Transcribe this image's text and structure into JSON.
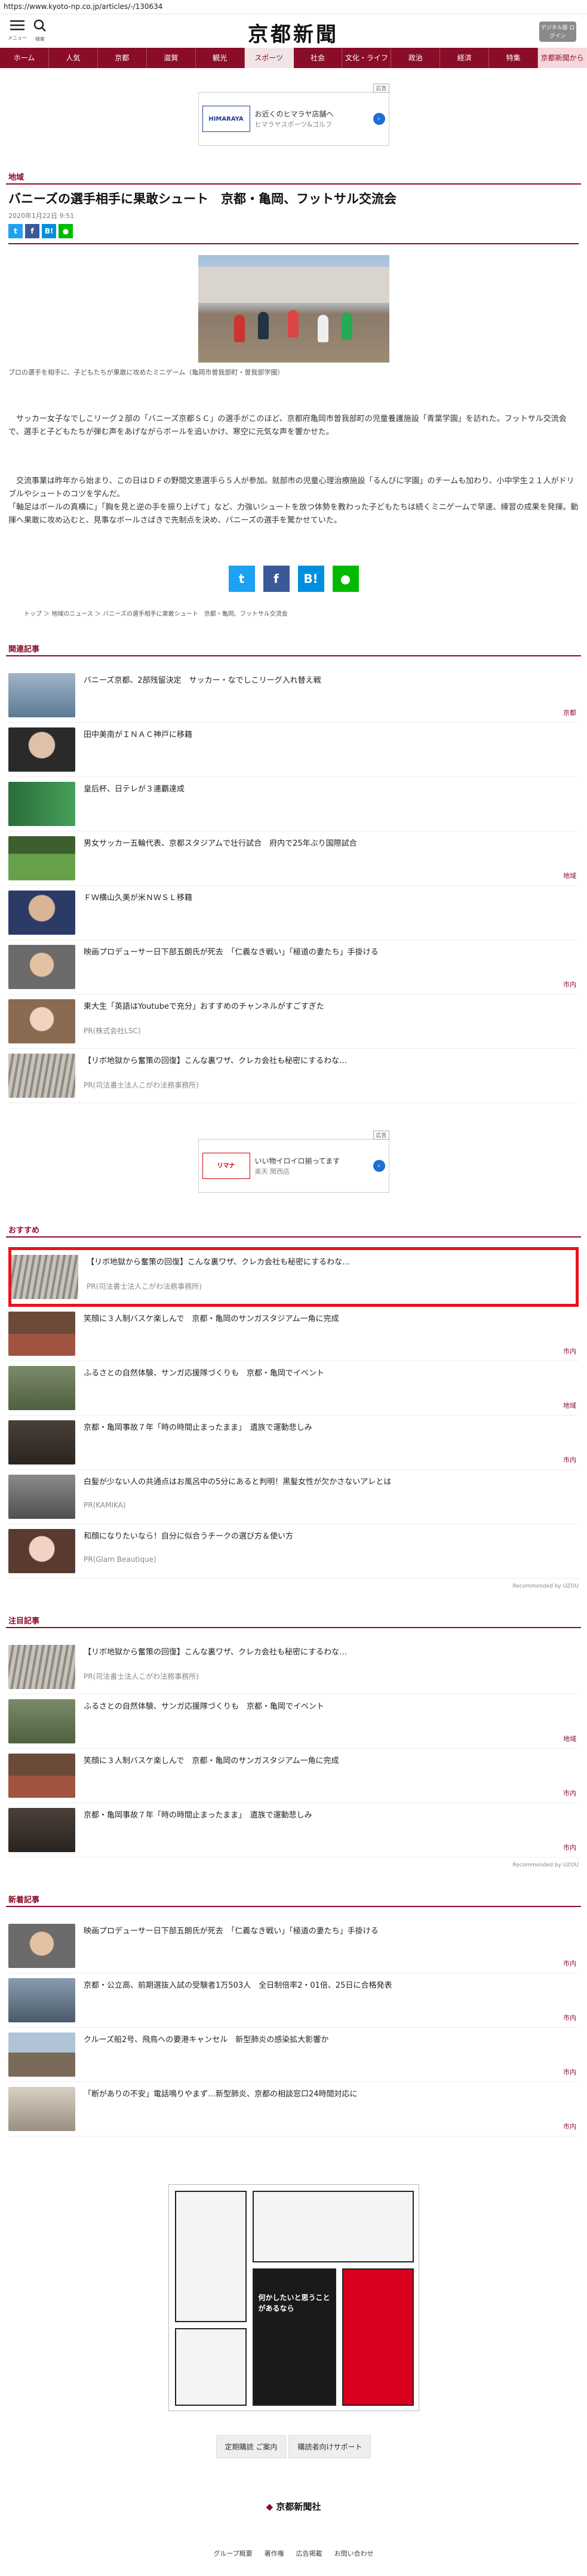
{
  "url": "https://www.kyoto-np.co.jp/articles/-/130634",
  "header": {
    "menu_label": "メニュー",
    "search_label": "検索",
    "logo": "京都新聞",
    "digital_button": "デジタル版 ログイン"
  },
  "nav": [
    "ホーム",
    "人気",
    "京都",
    "滋賀",
    "観光",
    "スポーツ",
    "社会",
    "文化・ライフ",
    "政治",
    "経済",
    "特集",
    "京都新聞から"
  ],
  "nav_active": "スポーツ",
  "top_ad": {
    "label": "広告",
    "logo": "HIMARAYA",
    "text": "お近くのヒマラヤ店舗へ",
    "sub": "ヒマラヤスポーツ&ゴルフ"
  },
  "article": {
    "category": "地域",
    "headline": "バニーズの選手相手に果敢シュート　京都・亀岡、フットサル交流会",
    "date": "2020年1月22日 9:51",
    "caption": "プロの選手を相手に、子どもたちが果敢に攻めたミニゲーム（亀岡市曽我部町・曽我部学園）",
    "paragraphs": [
      "　サッカー女子なでしこリーグ２部の「バニーズ京都ＳＣ」の選手がこのほど、京都府亀岡市曽我部町の児童養護施設「青葉学園」を訪れた。フットサル交流会で、選手と子どもたちが弾む声をあげながらボールを追いかけ、寒空に元気な声を響かせた。",
      "　交流事業は昨年から始まり、この日はＤＦの野間文恵選手ら５人が参加。就部市の児童心理治療施設「るんびに学園」のチームも加わり、小中学生２１人がドリブルやシュートのコツを学んだ。\n「軸足はボールの真横に」「胸を見と逆の手を振り上げて」など、力強いシュートを放つ体勢を教わった子どもたちは続くミニゲームで早速、練習の成果を発揮。動揮へ果敢に攻め込むと、見事なボールさばきで先制点を決め、バニーズの選手を驚かせていた。"
    ],
    "breadcrumbs": [
      "トップ",
      "地域のニュース",
      "バニーズの選手相手に果敢シュート　京都・亀岡、フットサル交流会"
    ]
  },
  "share_icons": [
    "twitter-icon",
    "facebook-icon",
    "hatena-icon",
    "line-icon"
  ],
  "related": {
    "title": "関連記事",
    "items": [
      {
        "text": "バニーズ京都、2部残留決定　サッカー・なでしこリーグ入れ替え戦",
        "tag": "京都"
      },
      {
        "text": "田中美南がＩＮＡＣ神戸に移籍",
        "tag": ""
      },
      {
        "text": "皇后杯、日テレが３連覇達成",
        "tag": ""
      },
      {
        "text": "男女サッカー五輪代表、京都スタジアムで壮行試合　府内で25年ぶり国際試合",
        "tag": "地域"
      },
      {
        "text": "ＦＷ横山久美が米ＮＷＳＬ移籍",
        "tag": ""
      },
      {
        "text": "映画プロデューサー日下部五朗氏が死去　「仁義なき戦い」「極道の妻たち」手掛ける",
        "tag": "市内"
      },
      {
        "text": "東大生「英語はYoutubeで充分」おすすめのチャンネルがすごすぎた",
        "pr": "PR(株式会社LSC)",
        "tag": ""
      },
      {
        "text": "【リボ地獄から奮策の回復】こんな裏ワザ、クレカ会社も秘密にするわな…",
        "pr": "PR(司法書士法人こがわ法務事務所)",
        "tag": ""
      }
    ]
  },
  "mid_ad": {
    "label": "広告",
    "logo": "リマナ",
    "text": "いい物イロイロ揃ってます",
    "sub": "楽天 関西店"
  },
  "recommend": {
    "title": "おすすめ",
    "items": [
      {
        "text": "【リボ地獄から奮策の回復】こんな裏ワザ、クレカ会社も秘密にするわな…",
        "pr": "PR(司法書士法人こがわ法務事務所)",
        "tag": ""
      },
      {
        "text": "笑顔に３人制バスケ楽しんで　京都・亀岡のサンガスタジアム一角に完成",
        "tag": "市内"
      },
      {
        "text": "ふるさとの自然体験、サンガ応援隊づくりも　京都・亀岡でイベント",
        "tag": "地域"
      },
      {
        "text": "京都・亀岡事故７年「時の時間止まったまま」　遺族で運動悲しみ",
        "tag": "市内"
      },
      {
        "text": "白髪が少ない人の共通点はお風呂中の5分にあると判明！黒髪女性が欠かさないアレとは",
        "pr": "PR(KAMIKA)",
        "tag": ""
      },
      {
        "text": "和顔になりたいなら！自分に似合うチークの選び方＆使い方",
        "pr": "PR(Glam Beautique)",
        "tag": ""
      }
    ],
    "recommended_by": "Recommended by UZOU"
  },
  "attention": {
    "title": "注目記事",
    "items": [
      {
        "text": "【リボ地獄から奮策の回復】こんな裏ワザ、クレカ会社も秘密にするわな…",
        "pr": "PR(司法書士法人こがわ法務事務所)",
        "tag": ""
      },
      {
        "text": "ふるさとの自然体験、サンガ応援隊づくりも　京都・亀岡でイベント",
        "tag": "地域"
      },
      {
        "text": "笑顔に３人制バスケ楽しんで　京都・亀岡のサンガスタジアム一角に完成",
        "tag": "市内"
      },
      {
        "text": "京都・亀岡事故７年「時の時間止まったまま」　遺族で運動悲しみ",
        "tag": "市内"
      }
    ],
    "recommended_by": "Recommended by UZOU"
  },
  "latest": {
    "title": "新着記事",
    "items": [
      {
        "text": "映画プロデューサー日下部五朗氏が死去　「仁義なき戦い」「極道の妻たち」手掛ける",
        "tag": "市内"
      },
      {
        "text": "京都・公立高、前期選抜入試の受験者1万503人　全日制倍率2・01倍、25日に合格発表",
        "tag": "市内"
      },
      {
        "text": "クルーズ船2号、飛鳥への要港キャンセル　新型肺炎の感染拡大影響か",
        "tag": "市内"
      },
      {
        "text": "「断がありの不安」電話鳴りやまず…新型肺炎、京都の相談窓口24時間対応に",
        "tag": "市内"
      }
    ]
  },
  "bottom": {
    "cartoon_caption": "何かしたいと思うことがあるなら",
    "links": [
      "定期購読 ご案内",
      "購読者向けサポート"
    ],
    "footer_logo": "京都新聞社",
    "footer_links": [
      "グループ概要",
      "著作権",
      "広告掲載",
      "お問い合わせ"
    ]
  }
}
